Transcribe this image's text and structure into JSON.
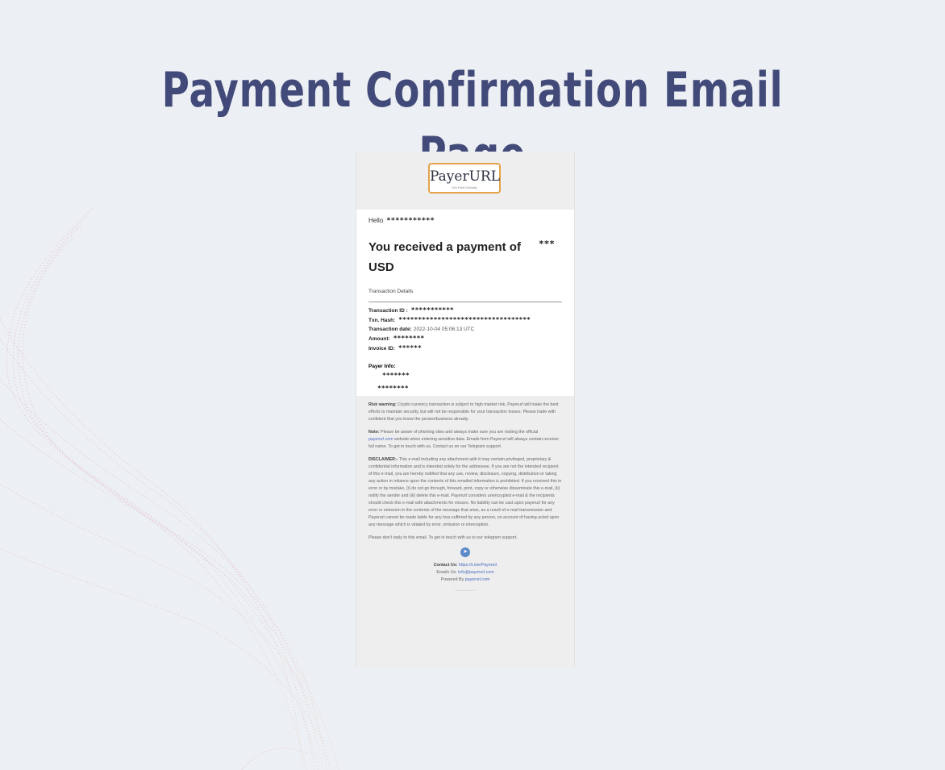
{
  "page": {
    "title": "Payment Confirmation Email Page"
  },
  "header": {
    "logo_text": "PayerURL",
    "logo_tagline": "Get Paid Globally"
  },
  "email": {
    "greeting": "Hello",
    "recipient_masked": "***********",
    "headline": "You received a payment of",
    "headline_currency": "USD",
    "headline_amount_masked": "***",
    "section_title": "Transaction Details",
    "details": {
      "transaction_id_label": "Transaction ID :",
      "transaction_id_masked": "***********",
      "txn_hash_label": "Txn. Hash:",
      "txn_hash_masked": "**********************************",
      "date_label": "Transaction date:",
      "date_value": "2022-10-04 05:06:13 UTC",
      "amount_label": "Amount:",
      "amount_masked": "********",
      "invoice_label": "Invoice ID:",
      "invoice_masked": "******"
    },
    "payer": {
      "label": "Payer Info:",
      "name_masked": "*******",
      "email_masked": "********"
    }
  },
  "footer": {
    "risk_label": "Risk warning:",
    "risk_text": "Crypto currency transaction is subject to high market risk. Payerurl will make the best efforts to maintain security, but will not be responsible for your transaction losses. Please trade with confident that you know the person/business already.",
    "note_label": "Note:",
    "note_text_1": "Please be aware of phishing sites and always make sure you are visiting the official",
    "note_link": "payerurl.com",
    "note_text_2": "website when entering sensitive data. Emails from Payerurl will always contain receiver full name. To get in touch with us, Contact us on our Telegram support.",
    "disclaimer_label": "DISCLAIMER:-",
    "disclaimer_text": "This e-mail including any attachment with it may contain privileged, proprietary & confidential information and is intended solely for the addressee. If you are not the intended recipient of this e-mail, you are hereby notified that any use, review, disclosure, copying, distribution or taking any action in reliance upon the contents of this emailed information is prohibited. If you received this in error or by mistake, (i) do not go through, forward, print, copy or otherwise disseminate this e-mail, (ii) notify the sender and (iii) delete this e-mail. Payerurl considers unencrypted e-mail & the recipients should check this e-mail with attachments for viruses. No liability can be cast upon payerurl for any error or omission in the contents of the message that arise, as a result of e-mail transmission and Payerurl cannot be made liable for any loss suffered by any person, on account of having acted upon any message which is vitiated by error, omission or interception.",
    "no_reply": "Please don't reply to this email. To get in touch with us to our telegram support.",
    "telegram_icon": "telegram-icon",
    "contact_label": "Contact Us:",
    "contact_link": "https://t.me/Payerurl",
    "email_label": "Emails Us:",
    "email_link": "info@payerurl.com",
    "powered_label": "Powered By",
    "powered_link": "payerurl.com"
  },
  "colors": {
    "title": "#424a79",
    "logo_border": "#e3a44a",
    "link": "#4a6cc2",
    "background": "#eceff3"
  }
}
